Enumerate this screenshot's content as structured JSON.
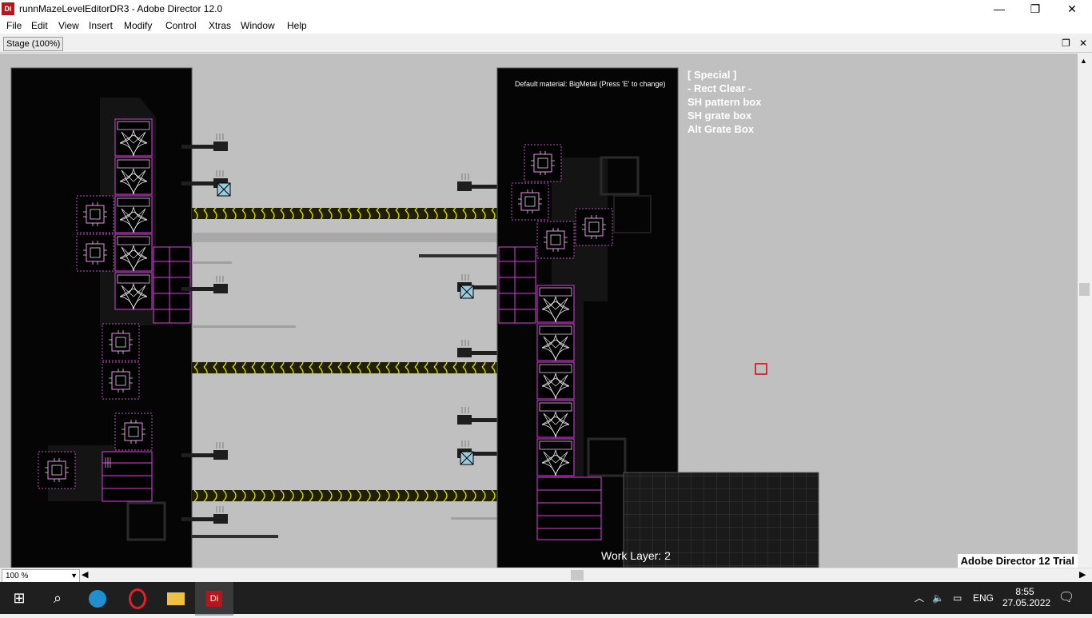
{
  "window": {
    "title": "runnMazeLevelEditorDR3 - Adobe Director 12.0",
    "app_icon_label": "Di",
    "controls": {
      "minimize": "—",
      "restore": "❐",
      "close": "✕"
    }
  },
  "menu": [
    "File",
    "Edit",
    "View",
    "Insert",
    "Modify",
    "Control",
    "Xtras",
    "Window",
    "Help"
  ],
  "stage_tab": {
    "label": "Stage (100%)"
  },
  "stage": {
    "default_material": "Default material: BigMetal (Press 'E' to change)",
    "special_lines": [
      "[ Special ]",
      "- Rect Clear -",
      "SH pattern box",
      "SH grate box",
      "Alt Grate Box"
    ],
    "work_layer": "Work Layer: 2",
    "trial_label": "Adobe Director 12 Trial"
  },
  "zoom": {
    "value": "100 %"
  },
  "taskbar": {
    "language": "ENG",
    "time": "8:55",
    "date": "27.05.2022"
  },
  "colors": {
    "accent_magenta": "#e040e0",
    "rope_yellow": "#e6e600",
    "cursor_red": "#e00000"
  }
}
